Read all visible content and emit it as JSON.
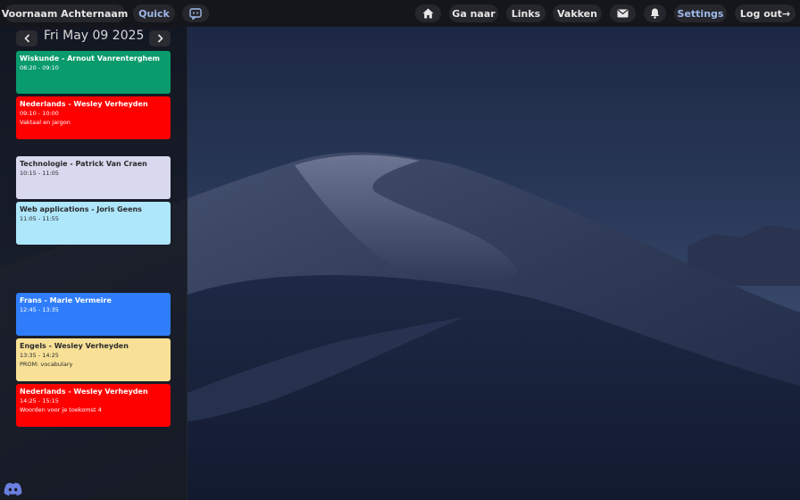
{
  "header": {
    "user_name": "Voornaam Achternaam",
    "quick_label": "Quick",
    "nav_goto_label": "Ga naar",
    "nav_links_label": "Links",
    "nav_subjects_label": "Vakken",
    "settings_label": "Settings",
    "logout_label": "Log out→"
  },
  "day": {
    "date_label": "Fri May 09 2025"
  },
  "schedule": [
    {
      "title": "Wiskunde - Arnout Vanrenterghem",
      "time": "08:20 - 09:10",
      "note": "",
      "color": "#0a9b6c"
    },
    {
      "title": "Nederlands - Wesley Verheyden",
      "time": "09:10 - 10:00",
      "note": "Vaktaal en jargon",
      "color": "#ff0000"
    },
    {
      "title": "Technologie - Patrick Van Craen",
      "time": "10:15 - 11:05",
      "note": "",
      "color": "#d8d8ee"
    },
    {
      "title": "Web applications - Joris Geens",
      "time": "11:05 - 11:55",
      "note": "",
      "color": "#aee6fb"
    },
    {
      "title": "Frans - Marie Vermeire",
      "time": "12:45 - 13:35",
      "note": "",
      "color": "#2f7dfa"
    },
    {
      "title": "Engels - Wesley Verheyden",
      "time": "13:35 - 14:25",
      "note": "PROM: vocabulary",
      "color": "#f8e197"
    },
    {
      "title": "Nederlands - Wesley Verheyden",
      "time": "14:25 - 15:15",
      "note": "Woorden voor je toekomst 4",
      "color": "#ff0000"
    }
  ],
  "icons": [
    "chat-icon",
    "home-icon",
    "mail-icon",
    "bell-icon",
    "chevron-left-icon",
    "chevron-right-icon",
    "discord-icon"
  ]
}
